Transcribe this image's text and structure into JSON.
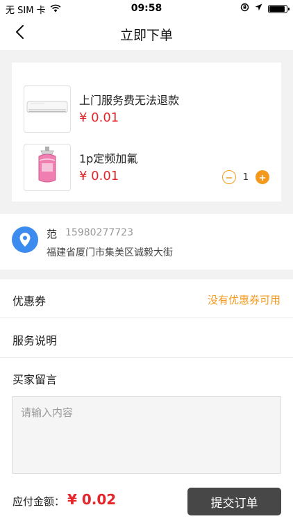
{
  "status_bar": {
    "carrier": "无 SIM 卡",
    "time": "09:58",
    "icons": [
      "wifi-icon",
      "orientation-lock-icon",
      "location-arrow-icon",
      "battery-icon"
    ]
  },
  "nav": {
    "title": "立即下单",
    "back_icon": "chevron-left-icon"
  },
  "products": [
    {
      "name": "上门服务费无法退款",
      "price": "¥ 0.01",
      "image_icon": "air-conditioner-icon"
    },
    {
      "name": "1p定频加氟",
      "price": "¥ 0.01",
      "image_icon": "refrigerant-tank-icon",
      "quantity": "1"
    }
  ],
  "address": {
    "name": "范",
    "phone": "15980277723",
    "detail": "福建省厦门市集美区诚毅大街",
    "icon": "location-pin-icon"
  },
  "coupon": {
    "label": "优惠券",
    "value": "没有优惠券可用"
  },
  "service": {
    "label": "服务说明"
  },
  "message": {
    "label": "买家留言",
    "placeholder": "请输入内容",
    "value": ""
  },
  "footer": {
    "total_label": "应付金额：",
    "total_amount": "¥ 0.02",
    "submit_label": "提交订单"
  },
  "colors": {
    "accent_orange": "#f39a1e",
    "price_red": "#e4262a",
    "location_blue": "#3c8cf0",
    "submit_bg": "#474747"
  }
}
